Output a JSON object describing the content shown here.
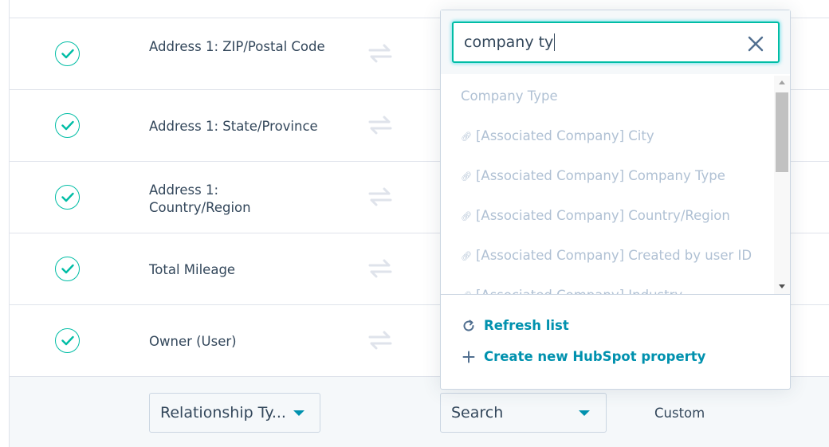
{
  "rows": [
    {
      "label": "Address 1: ZIP/Postal Code",
      "checked": true
    },
    {
      "label": "Address 1: State/Province",
      "checked": true
    },
    {
      "label": "Address 1: Country/Region",
      "checked": true
    },
    {
      "label": "Total Mileage",
      "checked": true
    },
    {
      "label": "Owner (User)",
      "checked": true
    }
  ],
  "footer": {
    "relationship_select": "Relationship Ty...",
    "search_select": "Search",
    "type_text": "Custom"
  },
  "dropdown": {
    "search_value": "company ty",
    "options": [
      {
        "label": "Company Type",
        "linked": false
      },
      {
        "label": "[Associated Company] City",
        "linked": true
      },
      {
        "label": "[Associated Company] Company Type",
        "linked": true
      },
      {
        "label": "[Associated Company] Country/Region",
        "linked": true
      },
      {
        "label": "[Associated Company] Created by user ID",
        "linked": true
      },
      {
        "label": "[Associated Company] Industry",
        "linked": true
      }
    ],
    "refresh_label": "Refresh list",
    "create_label": "Create new HubSpot property"
  },
  "colors": {
    "accent": "#0091ae",
    "check": "#00bda5",
    "text": "#33475b",
    "muted": "#b0c1d4"
  }
}
